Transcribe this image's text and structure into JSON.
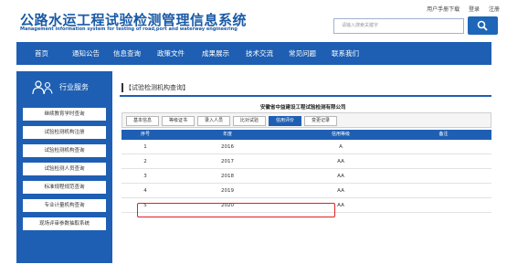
{
  "header": {
    "title": "公路水运工程试验检测管理信息系统",
    "subtitle": "Management information system for testing of road,port and waterway engineering",
    "top_links": [
      "用户手册下载",
      "登录",
      "注册"
    ],
    "search_placeholder": "请输入搜索关键字"
  },
  "nav": {
    "items": [
      "首页",
      "通知公告",
      "信息查询",
      "政策文件",
      "成果展示",
      "技术交流",
      "常见问题",
      "联系我们"
    ]
  },
  "sidebar": {
    "title": "行业服务",
    "items": [
      "继续教育学时查询",
      "试验检测机构注册",
      "试验检测机构查询",
      "试验检测人员查询",
      "标准规程规范查询",
      "专业计量机构查询",
      "现场评审参数抽取系统"
    ]
  },
  "main": {
    "title": "【试验检测机构查询】",
    "company": "安徽省中益建设工程试验检测有限公司",
    "tabs": [
      "基本信息",
      "等级证书",
      "录入人员",
      "比对试验",
      "信用评价",
      "变更记录"
    ],
    "active_tab": "信用评价",
    "table": {
      "headers": [
        "序号",
        "年度",
        "信用等级",
        "备注"
      ],
      "rows": [
        [
          "1",
          "2016",
          "A",
          ""
        ],
        [
          "2",
          "2017",
          "AA",
          ""
        ],
        [
          "3",
          "2018",
          "AA",
          ""
        ],
        [
          "4",
          "2019",
          "AA",
          ""
        ],
        [
          "5",
          "2020",
          "AA",
          ""
        ]
      ]
    }
  },
  "colors": {
    "primary": "#1e5fb3",
    "highlight": "#e02020"
  }
}
